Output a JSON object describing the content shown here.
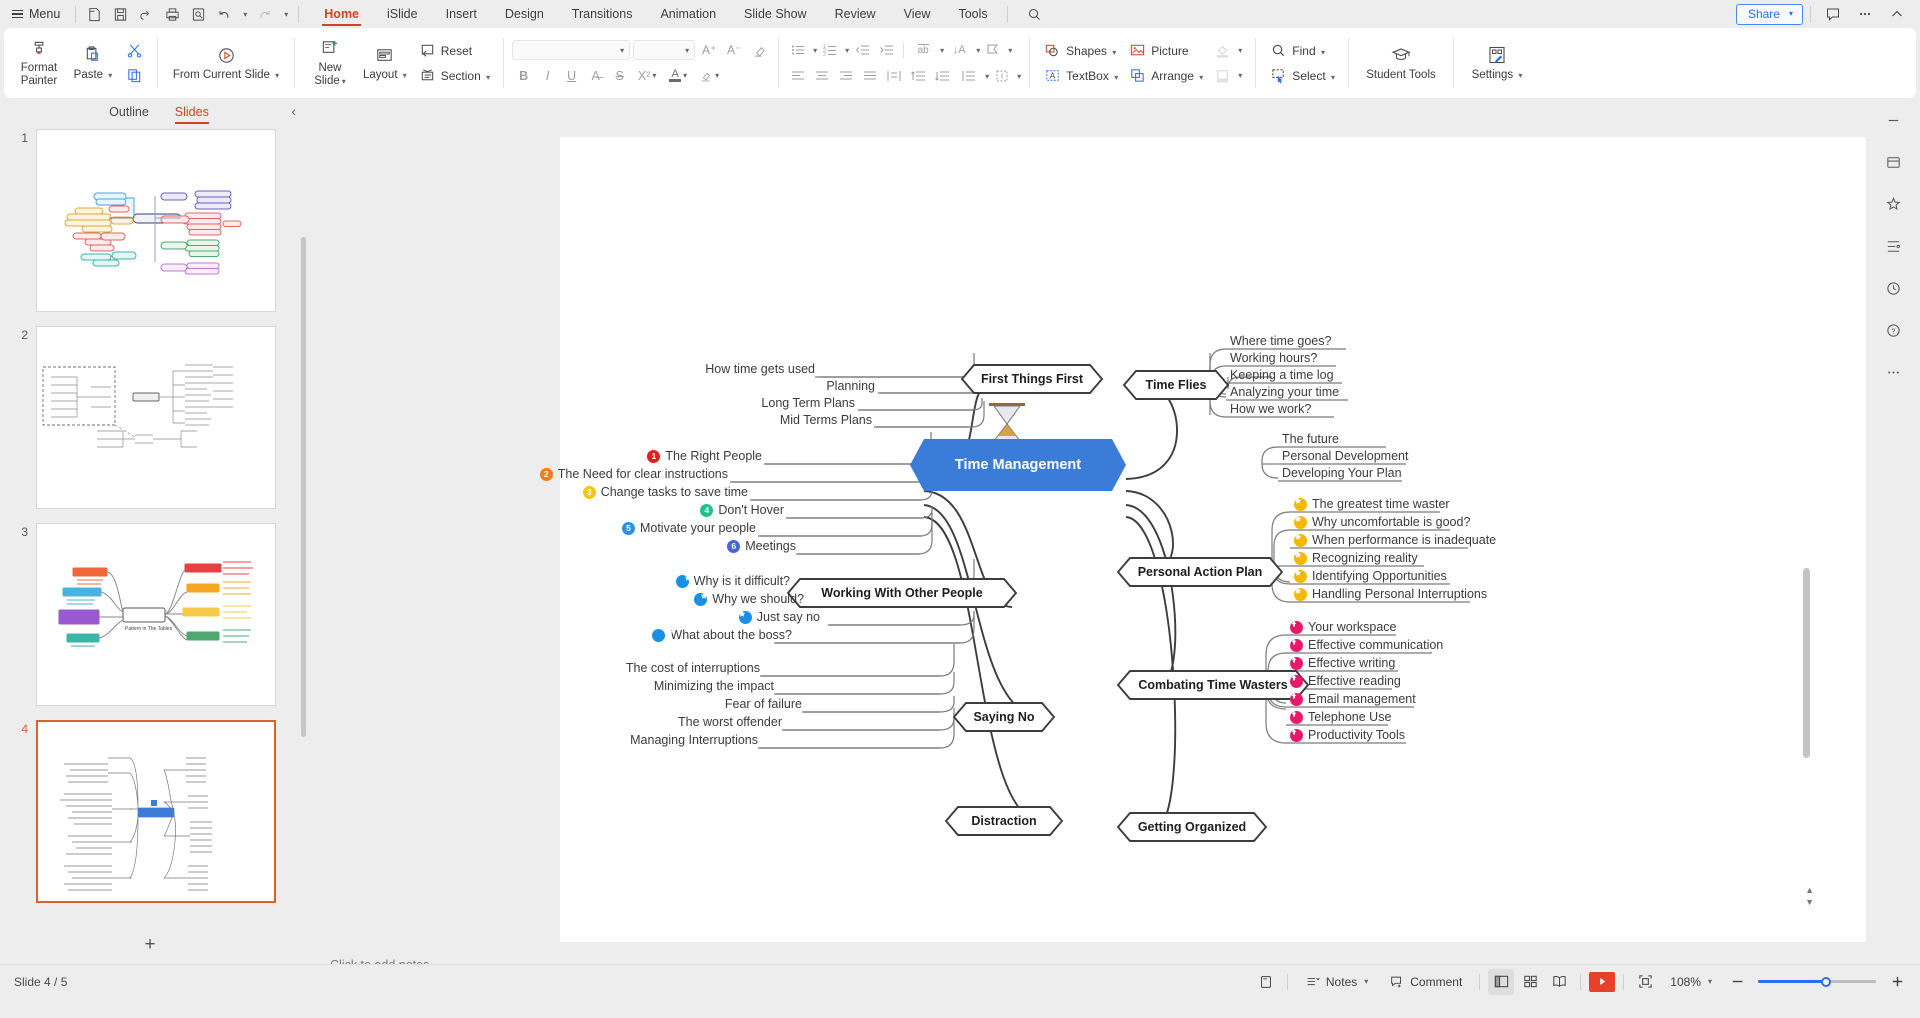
{
  "menubar": {
    "menu_label": "Menu",
    "quick_icons": [
      "new-file-icon",
      "save-icon",
      "print-preview-icon",
      "print-icon",
      "find-icon",
      "undo-icon",
      "redo-icon",
      "more-icon"
    ],
    "tabs": [
      {
        "label": "Home",
        "active": true
      },
      {
        "label": "iSlide",
        "active": false
      },
      {
        "label": "Insert",
        "active": false
      },
      {
        "label": "Design",
        "active": false
      },
      {
        "label": "Transitions",
        "active": false
      },
      {
        "label": "Animation",
        "active": false
      },
      {
        "label": "Slide Show",
        "active": false
      },
      {
        "label": "Review",
        "active": false
      },
      {
        "label": "View",
        "active": false
      },
      {
        "label": "Tools",
        "active": false
      }
    ],
    "share_label": "Share",
    "accent_orange": "#d04423",
    "accent_blue": "#2a6ef0"
  },
  "ribbon": {
    "format_painter": "Format\nPainter",
    "format_painter_line1": "Format",
    "format_painter_line2": "Painter",
    "paste": "Paste",
    "from_current_slide": "From Current Slide",
    "new_slide_line1": "New",
    "new_slide_line2": "Slide",
    "layout": "Layout",
    "reset": "Reset",
    "section": "Section",
    "font_name": "",
    "font_size": "",
    "shapes": "Shapes",
    "picture": "Picture",
    "textbox": "TextBox",
    "arrange": "Arrange",
    "find": "Find",
    "select": "Select",
    "student_tools": "Student Tools",
    "settings": "Settings",
    "format_buttons": [
      "B",
      "I",
      "U",
      "A",
      "S",
      "X²"
    ]
  },
  "left_panel": {
    "tabs": [
      {
        "label": "Outline",
        "active": false
      },
      {
        "label": "Slides",
        "active": true
      }
    ],
    "collapse_icon": "chevron-left-icon",
    "slides": [
      {
        "number": "1",
        "selected": false
      },
      {
        "number": "2",
        "selected": false
      },
      {
        "number": "3",
        "selected": false
      },
      {
        "number": "4",
        "selected": true
      }
    ],
    "add_slide_icon": "plus-icon"
  },
  "notes": {
    "placeholder": "Click to add notes"
  },
  "statusbar": {
    "slide_indicator": "Slide 4 / 5",
    "notes_label": "Notes",
    "comment_label": "Comment",
    "zoom_label": "108%",
    "fit_icon": "fit-slide-icon",
    "normal_view_icon": "normal-view-icon",
    "sorter_view_icon": "slide-sorter-icon",
    "reading_view_icon": "reading-view-icon",
    "play_icon": "play-icon",
    "zoom_out_icon": "minus-icon",
    "zoom_in_icon": "plus-icon"
  },
  "rail": {
    "items": [
      "minimize-icon",
      "layout-panel-icon",
      "ai-sparkle-icon",
      "align-icon",
      "history-icon",
      "help-icon",
      "more-dots-icon"
    ]
  },
  "mindmap": {
    "central": "Time Management",
    "central_color": "#3a7cd8",
    "central_icon": "hourglass-icon",
    "left_branches": [
      {
        "title": "First Things First",
        "children": [
          {
            "text": "How time gets used",
            "marker": "none"
          },
          {
            "text": "Planning",
            "marker": "none"
          },
          {
            "text": "Long Term Plans",
            "marker": "none"
          },
          {
            "text": "Mid Terms Plans",
            "marker": "none"
          }
        ]
      },
      {
        "title": "Working With Other People",
        "children": [
          {
            "text": "The Right People",
            "marker": "number",
            "label": "1",
            "color": "#e02020"
          },
          {
            "text": "The Need for clear instructions",
            "marker": "number",
            "label": "2",
            "color": "#f07c1c"
          },
          {
            "text": "Change tasks to save time",
            "marker": "number",
            "label": "3",
            "color": "#f5c518"
          },
          {
            "text": "Don't Hover",
            "marker": "number",
            "label": "4",
            "color": "#1fc08a"
          },
          {
            "text": "Motivate your people",
            "marker": "number",
            "label": "5",
            "color": "#2d8fe0"
          },
          {
            "text": "Meetings",
            "marker": "number",
            "label": "6",
            "color": "#4a63d8"
          }
        ]
      },
      {
        "title": "Saying No",
        "children": [
          {
            "text": "Why is it difficult?",
            "marker": "star",
            "color": "#1a8fe3"
          },
          {
            "text": "Why we should?",
            "marker": "star",
            "color": "#1a8fe3"
          },
          {
            "text": "Just say no",
            "marker": "star",
            "color": "#1a8fe3"
          },
          {
            "text": "What about the boss?",
            "marker": "star",
            "color": "#1a8fe3"
          }
        ]
      },
      {
        "title": "Distraction",
        "children": [
          {
            "text": "The cost of interruptions",
            "marker": "none"
          },
          {
            "text": "Minimizing the impact",
            "marker": "none"
          },
          {
            "text": "Fear of failure",
            "marker": "none"
          },
          {
            "text": "The worst offender",
            "marker": "none"
          },
          {
            "text": "Managing Interruptions",
            "marker": "none"
          }
        ]
      }
    ],
    "right_branches": [
      {
        "title": "Time Flies",
        "children": [
          {
            "text": "Where time goes?",
            "marker": "none"
          },
          {
            "text": "Working hours?",
            "marker": "none"
          },
          {
            "text": "Keeping a time log",
            "marker": "none"
          },
          {
            "text": "Analyzing your time",
            "marker": "none"
          },
          {
            "text": "How we work?",
            "marker": "none"
          }
        ]
      },
      {
        "title": "Personal Action Plan",
        "children": [
          {
            "text": "The future",
            "marker": "none"
          },
          {
            "text": "Personal Development",
            "marker": "none"
          },
          {
            "text": "Developing Your Plan",
            "marker": "none"
          }
        ]
      },
      {
        "title": "Combating Time Wasters",
        "children": [
          {
            "text": "The greatest time waster",
            "marker": "star",
            "color": "#f5b800"
          },
          {
            "text": "Why uncomfortable is good?",
            "marker": "star",
            "color": "#f5b800"
          },
          {
            "text": "When performance is inadequate",
            "marker": "star",
            "color": "#f5b800"
          },
          {
            "text": "Recognizing reality",
            "marker": "star",
            "color": "#f5b800"
          },
          {
            "text": "Identifying Opportunities",
            "marker": "star",
            "color": "#f5b800"
          },
          {
            "text": "Handling Personal Interruptions",
            "marker": "star",
            "color": "#f5b800"
          }
        ]
      },
      {
        "title": "Getting Organized",
        "children": [
          {
            "text": "Your workspace",
            "marker": "arrow",
            "color": "#e8196b"
          },
          {
            "text": "Effective communication",
            "marker": "arrow",
            "color": "#e8196b"
          },
          {
            "text": "Effective writing",
            "marker": "arrow",
            "color": "#e8196b"
          },
          {
            "text": "Effective reading",
            "marker": "arrow",
            "color": "#e8196b"
          },
          {
            "text": "Email management",
            "marker": "arrow",
            "color": "#e8196b"
          },
          {
            "text": "Telephone Use",
            "marker": "arrow",
            "color": "#e8196b"
          },
          {
            "text": "Productivity Tools",
            "marker": "arrow",
            "color": "#e8196b"
          }
        ]
      }
    ]
  }
}
